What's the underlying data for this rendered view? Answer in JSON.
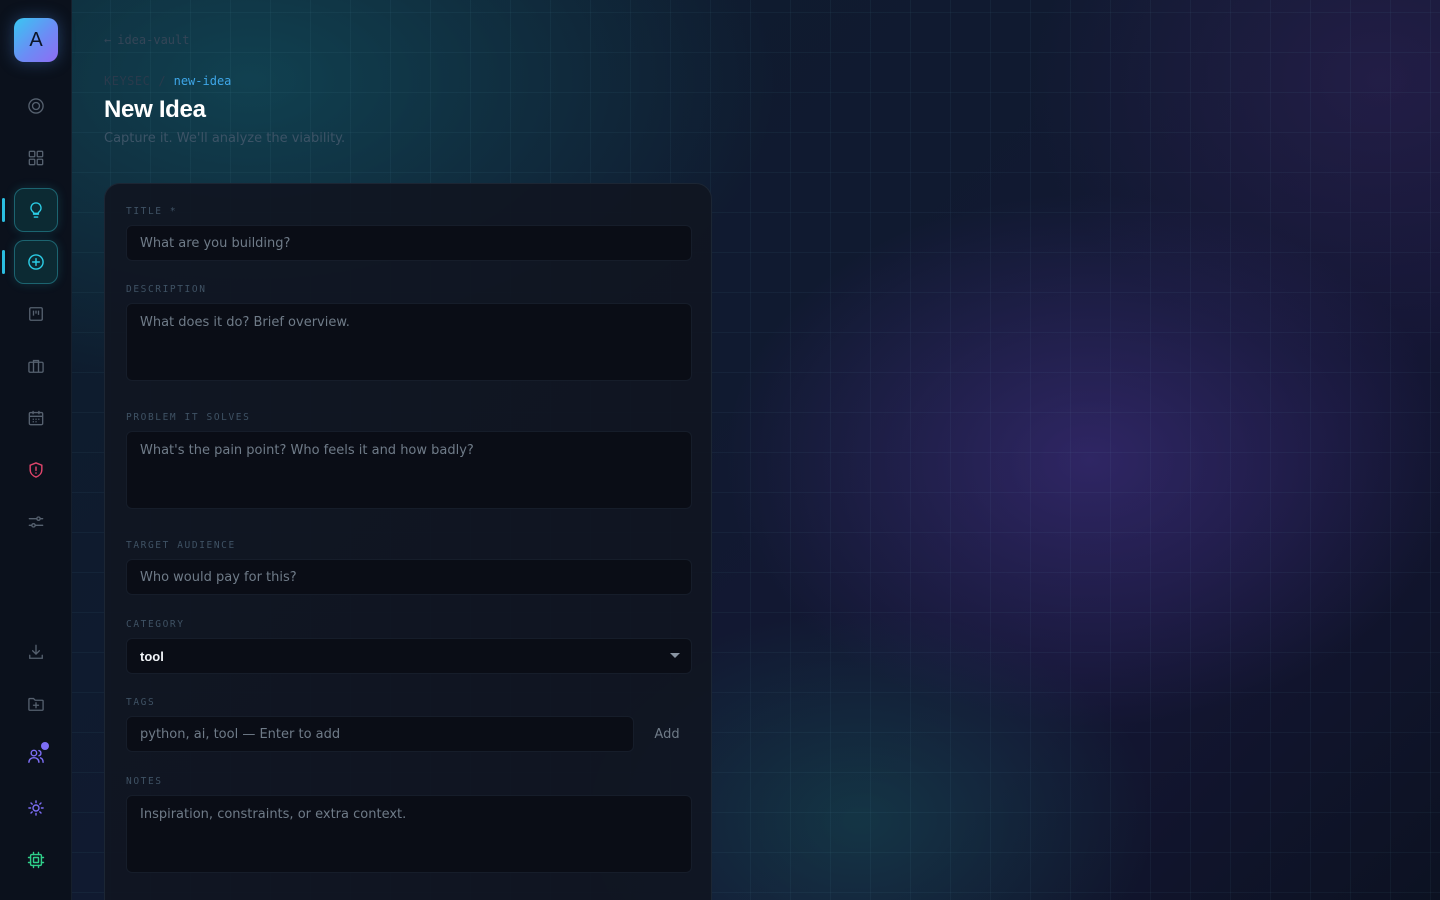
{
  "sidebar": {
    "logo_letter": "A",
    "icons": [
      {
        "name": "target-icon",
        "active": false
      },
      {
        "name": "dashboard-grid-icon",
        "active": false
      },
      {
        "name": "lightbulb-icon",
        "active": true
      },
      {
        "name": "plus-circle-icon",
        "active": true
      },
      {
        "name": "kanban-board-icon",
        "active": false
      },
      {
        "name": "briefcase-icon",
        "active": false
      },
      {
        "name": "calendar-icon",
        "active": false
      },
      {
        "name": "shield-alert-icon",
        "active": false
      },
      {
        "name": "sliders-icon",
        "active": false
      },
      {
        "name": "download-icon",
        "active": false
      },
      {
        "name": "folder-plus-icon",
        "active": false
      },
      {
        "name": "users-icon",
        "active": false
      },
      {
        "name": "sun-icon",
        "active": false
      },
      {
        "name": "cpu-chip-icon",
        "active": false
      }
    ]
  },
  "header": {
    "back_link": "idea-vault",
    "breadcrumb_root": "KEYSEC",
    "breadcrumb_separator": "/",
    "breadcrumb_current": "new-idea",
    "title": "New Idea",
    "subtitle": "Capture it. We'll analyze the viability."
  },
  "form": {
    "title": {
      "label": "TITLE *",
      "value": "",
      "placeholder": "What are you building?"
    },
    "description": {
      "label": "DESCRIPTION",
      "value": "",
      "placeholder": "What does it do? Brief overview."
    },
    "problem": {
      "label": "PROBLEM IT SOLVES",
      "value": "",
      "placeholder": "What's the pain point? Who feels it and how badly?"
    },
    "audience": {
      "label": "TARGET AUDIENCE",
      "value": "",
      "placeholder": "Who would pay for this?"
    },
    "category": {
      "label": "CATEGORY",
      "value": "tool"
    },
    "tags": {
      "label": "TAGS",
      "value": "",
      "placeholder": "python, ai, tool — Enter to add",
      "add_label": "Add"
    },
    "notes": {
      "label": "NOTES",
      "value": "",
      "placeholder": "Inspiration, constraints, or extra context."
    }
  },
  "colors": {
    "accent": "#2bbde0",
    "breadcrumb_current": "#3ea6e8",
    "shield": "#e0456b",
    "users": "#7d6ef5",
    "chip": "#2fd08a"
  }
}
